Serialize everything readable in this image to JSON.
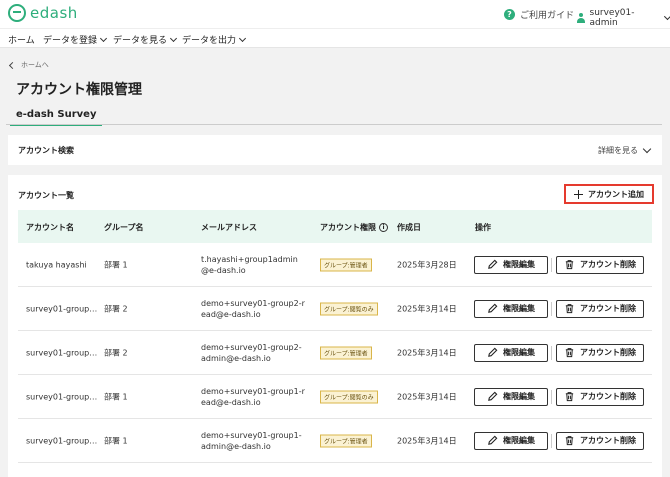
{
  "header": {
    "logo_text": "edash",
    "guide_label": "ご利用ガイド",
    "user_name": "survey01-admin"
  },
  "nav": {
    "items": [
      {
        "label": "ホーム",
        "has_menu": false
      },
      {
        "label": "データを登録",
        "has_menu": true
      },
      {
        "label": "データを見る",
        "has_menu": true
      },
      {
        "label": "データを出力",
        "has_menu": true
      }
    ]
  },
  "page": {
    "back_label": "ホームへ",
    "title": "アカウント権限管理",
    "tab_label": "e-dash Survey"
  },
  "search": {
    "title": "アカウント検索",
    "detail_label": "詳細を見る"
  },
  "list": {
    "title": "アカウント一覧",
    "add_button_label": "アカウント追加",
    "columns": {
      "account": "アカウント名",
      "group": "グループ名",
      "email": "メールアドレス",
      "permission": "アカウント権限",
      "created": "作成日",
      "actions": "操作"
    },
    "edit_label": "権限編集",
    "delete_label": "アカウント削除",
    "rows": [
      {
        "account": "takuya hayashi",
        "group": "部署 1",
        "email": "t.hayashi+group1admin@e-dash.io",
        "permission": "グループ:管理者",
        "created": "2025年3月28日"
      },
      {
        "account": "survey01-group…",
        "group": "部署 2",
        "email": "demo+survey01-group2-read@e-dash.io",
        "permission": "グループ:閲覧のみ",
        "created": "2025年3月14日"
      },
      {
        "account": "survey01-group…",
        "group": "部署 2",
        "email": "demo+survey01-group2-admin@e-dash.io",
        "permission": "グループ:管理者",
        "created": "2025年3月14日"
      },
      {
        "account": "survey01-group…",
        "group": "部署 1",
        "email": "demo+survey01-group1-read@e-dash.io",
        "permission": "グループ:閲覧のみ",
        "created": "2025年3月14日"
      },
      {
        "account": "survey01-group…",
        "group": "部署 1",
        "email": "demo+survey01-group1-admin@e-dash.io",
        "permission": "グループ:管理者",
        "created": "2025年3月14日"
      }
    ]
  },
  "colors": {
    "brand": "#2eae7c",
    "highlight": "#e53a2e",
    "table_header": "#e9f7f1",
    "badge_bg": "#fbf2d3"
  }
}
